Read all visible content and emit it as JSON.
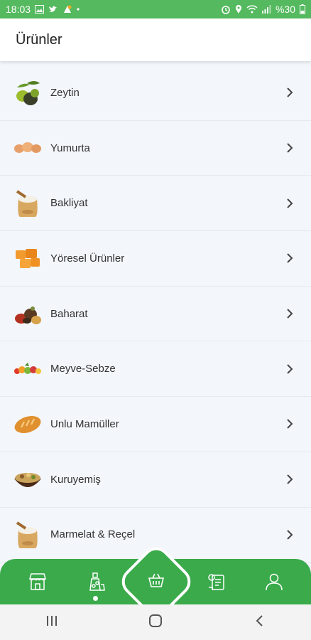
{
  "status_bar": {
    "time": "18:03",
    "battery": "%30"
  },
  "header": {
    "title": "Ürünler"
  },
  "products": [
    {
      "label": "Zeytin",
      "icon": "olive-icon"
    },
    {
      "label": "Yumurta",
      "icon": "egg-icon"
    },
    {
      "label": "Bakliyat",
      "icon": "grain-sack-icon"
    },
    {
      "label": "Yöresel Ürünler",
      "icon": "regional-products-icon"
    },
    {
      "label": "Baharat",
      "icon": "spice-icon"
    },
    {
      "label": "Meyve-Sebze",
      "icon": "fruit-vegetable-icon"
    },
    {
      "label": "Unlu Mamüller",
      "icon": "bread-icon"
    },
    {
      "label": "Kuruyemiş",
      "icon": "nuts-bowl-icon"
    },
    {
      "label": "Marmelat & Reçel",
      "icon": "jam-sack-icon"
    }
  ],
  "bottom_nav": {
    "items": [
      "store-icon",
      "products-icon",
      "basket-icon",
      "orders-icon",
      "profile-icon"
    ],
    "active": "products-icon"
  },
  "colors": {
    "primary": "#3aaa4b",
    "status_bar": "#55b95f",
    "background": "#f3f6fb"
  }
}
